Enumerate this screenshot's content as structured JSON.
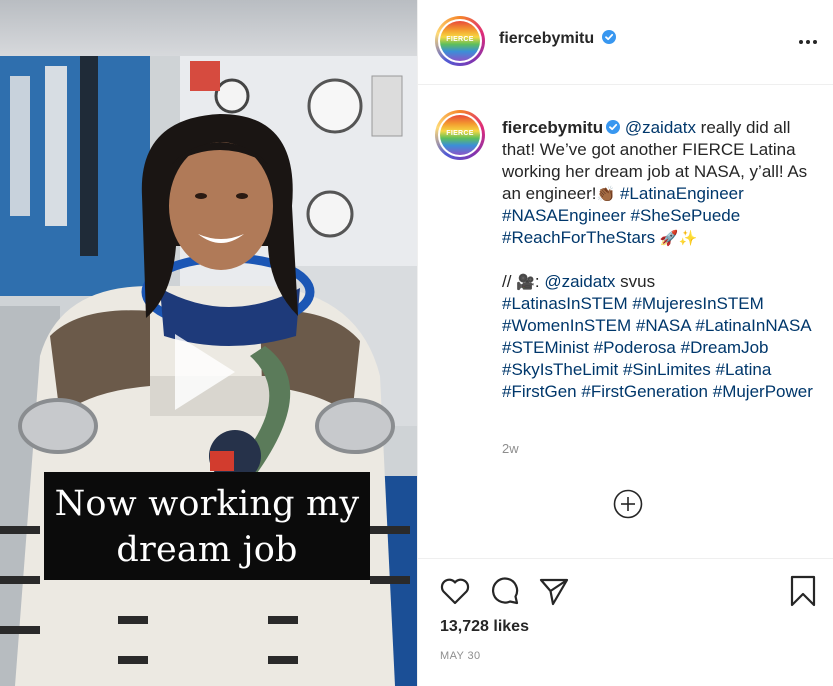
{
  "account": {
    "username": "fiercebymitu",
    "avatar_text": "FIERCE",
    "verified": true
  },
  "media": {
    "overlay_text_line1": "Now working my",
    "overlay_text_line2": "dream job",
    "type": "video"
  },
  "caption": {
    "username": "fiercebymitu",
    "mention": "@zaidatx",
    "text1": " really did all that! We’ve got another FIERCE Latina working her dream job at NASA, y’all! As an engineer!",
    "emoji_hand": "👏🏾",
    "tags1": [
      "#LatinaEngineer",
      "#NASAEngineer",
      "#SheSePuede",
      "#ReachForTheStars"
    ],
    "emoji_end": "🚀✨",
    "credit_prefix": "// ",
    "camera_emoji": "🎥",
    "credit_sep": ": ",
    "credit_mention": "@zaidatx",
    "credit_suffix": " svus",
    "tags2": [
      "#LatinasInSTEM",
      "#MujeresInSTEM",
      "#WomenInSTEM",
      "#NASA",
      "#LatinaInNASA",
      "#STEMinist",
      "#Poderosa",
      "#DreamJob",
      "#SkyIsTheLimit",
      "#SinLimites",
      "#Latina",
      "#FirstGen",
      "#FirstGeneration",
      "#MujerPower"
    ]
  },
  "time_ago": "2w",
  "likes_text": "13,728 likes",
  "date_text": "MAY 30",
  "icons": {
    "more": "more-options-icon",
    "like": "heart-icon",
    "comment": "comment-icon",
    "share": "share-icon",
    "save": "bookmark-icon",
    "load_more": "plus-circle-icon",
    "play": "play-icon"
  },
  "colors": {
    "link": "#00376b",
    "verified": "#3897f0",
    "muted": "#8e8e8e",
    "text": "#262626"
  }
}
